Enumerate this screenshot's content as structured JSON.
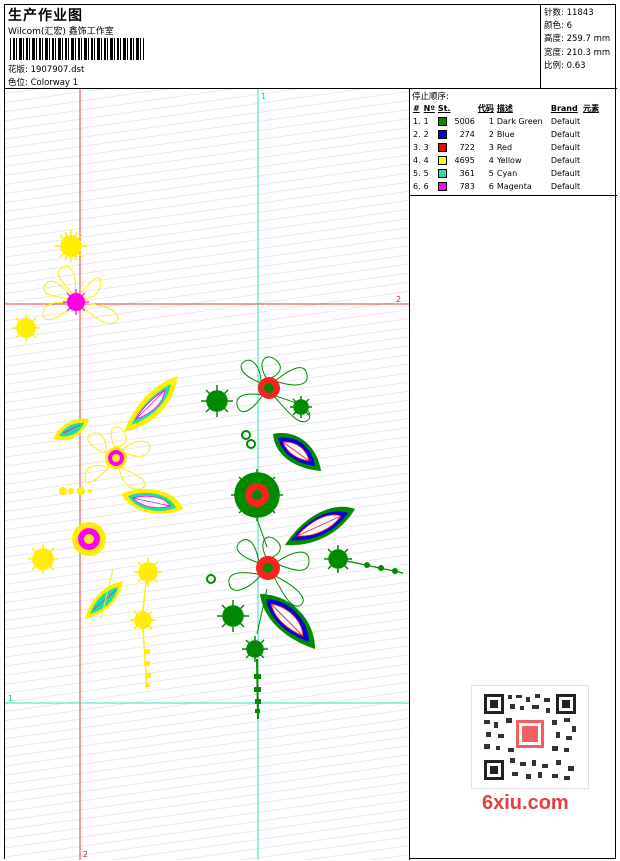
{
  "header": {
    "title": "生产作业图",
    "company": "Wilcom(汇宏) 鑫饰工作室",
    "design_label": "花版:",
    "design_value": "1907907.dst",
    "colorway_label": "色位:",
    "colorway_value": "Colorway 1"
  },
  "stats": [
    {
      "label": "针数:",
      "value": "11843"
    },
    {
      "label": "颜色:",
      "value": "6"
    },
    {
      "label": "高度:",
      "value": "259.7 mm"
    },
    {
      "label": "宽度:",
      "value": "210.3 mm"
    },
    {
      "label": "比例:",
      "value": "0.63"
    }
  ],
  "stop_sequence": {
    "title": "停止顺序:",
    "columns": [
      "#",
      "Nº",
      "St.",
      "代码",
      "描述",
      "Brand",
      "元素"
    ],
    "rows": [
      {
        "n": "1.",
        "no": "1",
        "color": "#008a00",
        "stitches": "5006",
        "code": "1",
        "desc": "Dark Green",
        "brand": "Default"
      },
      {
        "n": "2.",
        "no": "2",
        "color": "#0000e0",
        "stitches": "274",
        "code": "2",
        "desc": "Blue",
        "brand": "Default"
      },
      {
        "n": "3.",
        "no": "3",
        "color": "#ff0000",
        "stitches": "722",
        "code": "3",
        "desc": "Red",
        "brand": "Default"
      },
      {
        "n": "4.",
        "no": "4",
        "color": "#ffff00",
        "stitches": "4695",
        "code": "4",
        "desc": "Yellow",
        "brand": "Default"
      },
      {
        "n": "5.",
        "no": "5",
        "color": "#20e0a0",
        "stitches": "361",
        "code": "5",
        "desc": "Cyan",
        "brand": "Default"
      },
      {
        "n": "6.",
        "no": "6",
        "color": "#ff00ff",
        "stitches": "783",
        "code": "6",
        "desc": "Magenta",
        "brand": "Default"
      }
    ]
  },
  "canvas": {
    "guide_labels": {
      "vertical_red": "2",
      "horizontal_red": "2",
      "vertical_cyan": "1",
      "horizontal_cyan": "1"
    }
  },
  "watermark": "6xiu.com"
}
